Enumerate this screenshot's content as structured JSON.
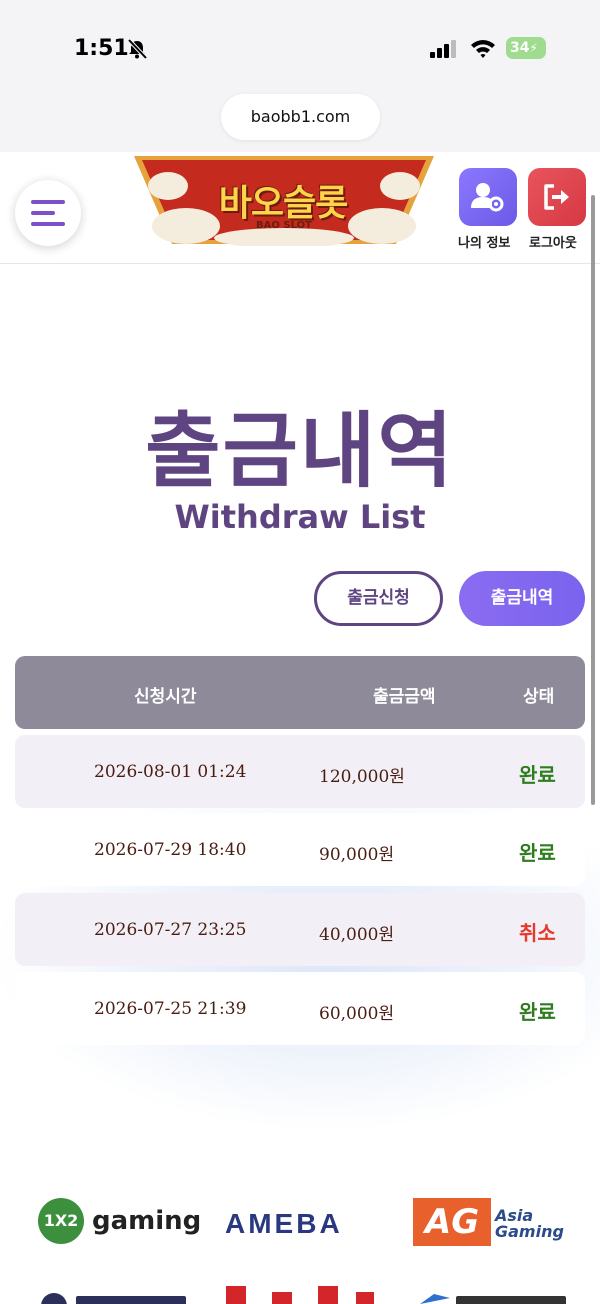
{
  "status_bar": {
    "time": "1:51",
    "battery": "34"
  },
  "browser": {
    "url": "baobb1.com"
  },
  "header": {
    "logo_text": "바오슬롯",
    "logo_sub": "BAO SLOT",
    "profile_label": "나의 정보",
    "logout_label": "로그아웃"
  },
  "page": {
    "title": "출금내역",
    "subtitle": "Withdraw List",
    "tab_apply": "출금신청",
    "tab_list": "출금내역"
  },
  "table": {
    "headers": {
      "time": "신청시간",
      "amount": "출금금액",
      "status": "상태"
    },
    "rows": [
      {
        "date": "2026-08-01 01:24",
        "amount": "120,000원",
        "status": "완료"
      },
      {
        "date": "2026-07-29 18:40",
        "amount": "90,000원",
        "status": "완료"
      },
      {
        "date": "2026-07-27 23:25",
        "amount": "40,000원",
        "status": "취소"
      },
      {
        "date": "2026-07-25 21:39",
        "amount": "60,000원",
        "status": "완료"
      }
    ],
    "status_colors": {
      "완료": "#2e7d1f",
      "취소": "#e53929"
    }
  },
  "providers": {
    "p1_badge": "1X2",
    "p1_name": "gaming",
    "p2_name": "AMEBA",
    "p3_badge": "AG",
    "p3_line1": "Asia",
    "p3_line2": "Gaming"
  },
  "colors": {
    "brand": "#5e4582",
    "accent": "#7b63ee"
  }
}
